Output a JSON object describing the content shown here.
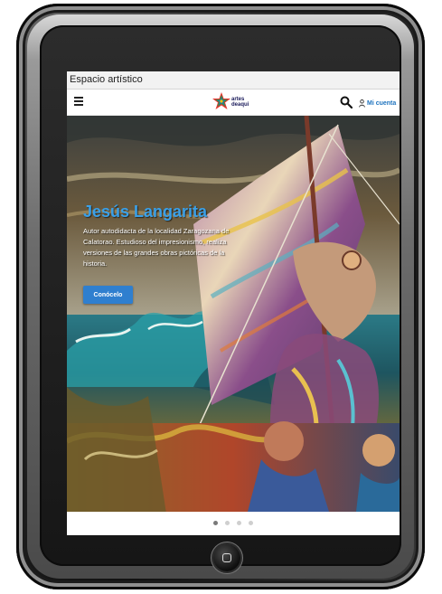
{
  "window": {
    "title": "Espacio artístico"
  },
  "navbar": {
    "menu_icon": "hamburger-icon",
    "logo_text_line1": "artes",
    "logo_text_line2": "deaqui",
    "search_icon": "search-icon",
    "account_icon": "user-icon",
    "account_label": "Mi cuenta"
  },
  "hero": {
    "title": "Jesús Langarita",
    "description": "Autor autodidacta de la localidad Zaragozana de Calatorao. Estudioso del impresionismo, realiza versiones de las grandes obras pictóricas de la historia.",
    "cta_label": "Conócelo"
  },
  "carousel": {
    "slides": 4,
    "active_index": 0
  },
  "colors": {
    "accent": "#2f7fcf",
    "title_blue": "#3aa0e8",
    "link_blue": "#1e73be"
  }
}
